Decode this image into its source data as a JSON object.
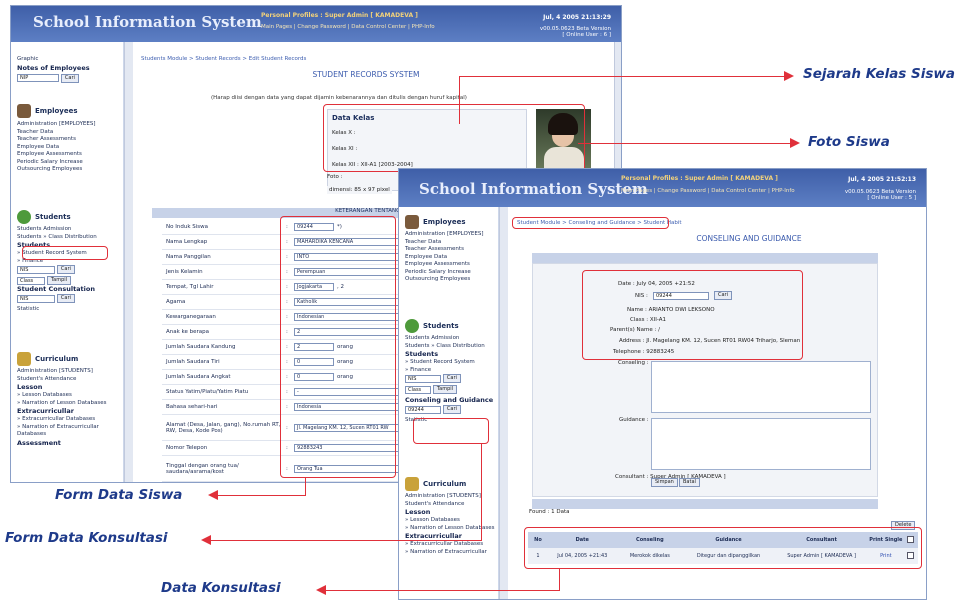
{
  "app_title": "School Information System",
  "back_window": {
    "profile": "Personal Profiles : Super Admin [ KAMADEVA ]",
    "links": "Main Pages | Change Password | Data Control Center | PHP-Info",
    "date": "Jul, 4 2005 21:13:29",
    "version": "v00.05.0623 Beta Version",
    "online": "[ Online User : 6 ]",
    "breadcrumb": "Students Module > Student Records > Edit Student Records",
    "section_title": "STUDENT RECORDS SYSTEM",
    "instruction": "(Harap diisi dengan data yang dapat dijamin kebenarannya dan ditulis dengan huruf kapital)",
    "data_kelas": {
      "title": "Data Kelas",
      "kelas_x": "Kelas X :",
      "kelas_xi": "Kelas XI :",
      "kelas_xii": "Kelas XII : XII-A1 [2003-2004]",
      "foto_label": "Foto :",
      "foto_dim": "dimensi: 85 x 97 pixel"
    },
    "form_header": "KETERANGAN TENTANG DI",
    "form": [
      {
        "label": "No Induk Siswa",
        "value": "09244",
        "suffix": "*)"
      },
      {
        "label": "Nama Lengkap",
        "value": "MAHARDIKA KENCANA"
      },
      {
        "label": "Nama Panggilan",
        "value": "INTO"
      },
      {
        "label": "Jenis Kelamin",
        "value": "Perempuan"
      },
      {
        "label": "Tempat, Tgl Lahir",
        "value": "Jogjakarta",
        "suffix": ", 2"
      },
      {
        "label": "Agama",
        "value": "Katholik"
      },
      {
        "label": "Kewarganegaraan",
        "value": "Indonesian"
      },
      {
        "label": "Anak ke berapa",
        "value": "2"
      },
      {
        "label": "Jumlah Saudara Kandung",
        "value": "2",
        "suffix": "orang"
      },
      {
        "label": "Jumlah Saudara Tiri",
        "value": "0",
        "suffix": "orang"
      },
      {
        "label": "Jumlah Saudara Angkat",
        "value": "0",
        "suffix": "orang"
      },
      {
        "label": "Status Yatim/Piatu/Yatim Piatu",
        "value": "-"
      },
      {
        "label": "Bahasa sehari-hari",
        "value": "Indonesia"
      },
      {
        "label": "Alamat (Desa, Jalan, gang), No.rumah RT, RW, Desa, Kode Pos)",
        "value": "Jl. Magelang KM. 12, Sucen RT01 RW"
      },
      {
        "label": "Nomor Telepon",
        "value": "92883243"
      },
      {
        "label": "Tinggal dengan orang tua/ saudara/asrama/kost",
        "value": "Orang Tua"
      }
    ],
    "sidebar": {
      "graphic": "Graphic",
      "notes_title": "Notes of Employees",
      "notes_input": "NIP",
      "cari": "Cari",
      "employees_title": "Employees",
      "employees_items": [
        "Administration [EMPLOYEES]",
        "Teacher Data",
        "Teacher Assessments",
        "Employee Data",
        "Employee Assessments",
        "Periodic Salary Increase",
        "Outsourcing Employees"
      ],
      "students_title": "Students",
      "students_items": [
        "Students Admission",
        "Students » Class Distribution"
      ],
      "students_bold": "Students",
      "student_record": "» Student Record System",
      "finance": "» Finance",
      "nis": "NIS",
      "class": "Class",
      "tampil": "Tampil",
      "consult_title": "Student Consultation",
      "statistic": "Statistic",
      "curriculum_title": "Curriculum",
      "curriculum_items": [
        "Administration [STUDENTS]",
        "Student's Attendance"
      ],
      "lesson": "Lesson",
      "lesson_items": [
        "» Lesson Databases",
        "» Narration of Lesson Databases"
      ],
      "extra": "Extracurricullar",
      "extra_items": [
        "» Extracurricullar Databases",
        "» Narration of Extracurricullar Databases"
      ],
      "assessment": "Assessment"
    }
  },
  "front_window": {
    "profile": "Personal Profiles : Super Admin [ KAMADEVA ]",
    "links": "Main Pages | Change Password | Data Control Center | PHP-Info",
    "date": "Jul, 4 2005 21:52:13",
    "version": "v00.05.0623 Beta Version",
    "online": "[ Online User : 5 ]",
    "breadcrumb": "Student Module > Conseling and Guidance > Student Habit",
    "section_title": "CONSELING AND GUIDANCE",
    "form": {
      "date": "Date : July 04, 2005 +21:52",
      "nis_label": "NIS :",
      "nis_value": "09244",
      "cari": "Cari",
      "name": "Name : ARIANTO DWI LEKSONO",
      "class": "Class : XII-A1",
      "parent": "Parent(s) Name : /",
      "address": "Address : Jl. Magelang KM. 12, Sucen RT01 RW04 Triharjo, Sleman",
      "telephone": "Telephone : 92883245",
      "conseling": "Conseling :",
      "guidance": "Guidance :",
      "consultant": "Consultant : Super Admin [ KAMADEVA ]",
      "simpan": "Simpan",
      "batal": "Batal"
    },
    "found": "Found : 1 Data",
    "delete": "Delete",
    "table": {
      "headers": [
        "No",
        "Date",
        "Conseling",
        "Guidance",
        "Consultant",
        "Print Single"
      ],
      "rows": [
        {
          "no": "1",
          "date": "Jul 04, 2005 +21:43",
          "conseling": "Merokok dikelas",
          "guidance": "Ditegur dan dipanggilkan",
          "consultant": "Super Admin [ KAMADEVA ]",
          "print": "Print"
        }
      ]
    },
    "sidebar": {
      "employees_title": "Employees",
      "employees_items": [
        "Administration [EMPLOYEES]",
        "Teacher Data",
        "Teacher Assessments",
        "Employee Data",
        "Employee Assessments",
        "Periodic Salary Increase",
        "Outsourcing Employees"
      ],
      "students_title": "Students",
      "students_items": [
        "Students Admission",
        "Students » Class Distribution"
      ],
      "students_bold": "Students",
      "student_record": "» Student Record System",
      "finance": "» Finance",
      "nis": "NIS",
      "cari": "Cari",
      "class": "Class",
      "tampil": "Tampil",
      "consult_title": "Conseling and Guidance",
      "consult_value": "09244",
      "statistic": "Statistic",
      "curriculum_title": "Curriculum",
      "curriculum_items": [
        "Administration [STUDENTS]",
        "Student's Attendance"
      ],
      "lesson": "Lesson",
      "lesson_items": [
        "» Lesson Databases",
        "» Narration of Lesson Databases"
      ],
      "extra": "Extracurricullar",
      "extra_items": [
        "» Extracurricullar Databases",
        "» Narration of Extracurricullar"
      ]
    }
  },
  "callouts": {
    "sejarah": "Sejarah Kelas Siswa",
    "foto": "Foto Siswa",
    "form_siswa": "Form Data Siswa",
    "form_konsultasi": "Form Data Konsultasi",
    "data_konsultasi": "Data Konsultasi"
  }
}
